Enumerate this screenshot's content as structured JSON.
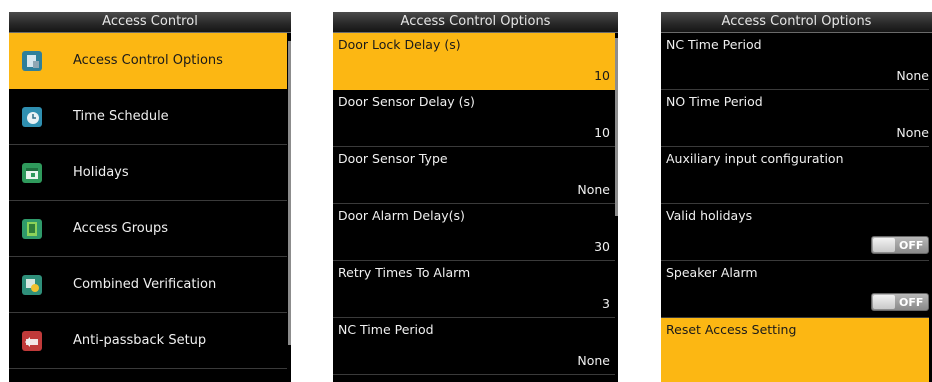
{
  "screen1": {
    "title": "Access Control",
    "items": [
      {
        "label": "Access Control Options",
        "icon": "access-options-icon"
      },
      {
        "label": "Time Schedule",
        "icon": "time-schedule-icon"
      },
      {
        "label": "Holidays",
        "icon": "holidays-icon"
      },
      {
        "label": "Access Groups",
        "icon": "access-groups-icon"
      },
      {
        "label": "Combined Verification",
        "icon": "combined-verification-icon"
      },
      {
        "label": "Anti-passback Setup",
        "icon": "anti-passback-icon"
      }
    ]
  },
  "screen2": {
    "title": "Access Control Options",
    "items": [
      {
        "label": "Door Lock Delay (s)",
        "value": "10"
      },
      {
        "label": "Door Sensor Delay (s)",
        "value": "10"
      },
      {
        "label": "Door Sensor Type",
        "value": "None"
      },
      {
        "label": "Door Alarm Delay(s)",
        "value": "30"
      },
      {
        "label": "Retry Times To Alarm",
        "value": "3"
      },
      {
        "label": "NC Time Period",
        "value": "None"
      }
    ]
  },
  "screen3": {
    "title": "Access Control Options",
    "items": [
      {
        "label": "NC Time Period",
        "value": "None"
      },
      {
        "label": "NO Time Period",
        "value": "None"
      },
      {
        "label": "Auxiliary input configuration",
        "value": ""
      },
      {
        "label": "Valid holidays",
        "toggle": "OFF"
      },
      {
        "label": "Speaker Alarm",
        "toggle": "OFF"
      },
      {
        "label": "Reset Access Setting",
        "value": ""
      }
    ]
  },
  "colors": {
    "highlight": "#fcb713",
    "background": "#000000",
    "text": "#f0f0f0"
  }
}
